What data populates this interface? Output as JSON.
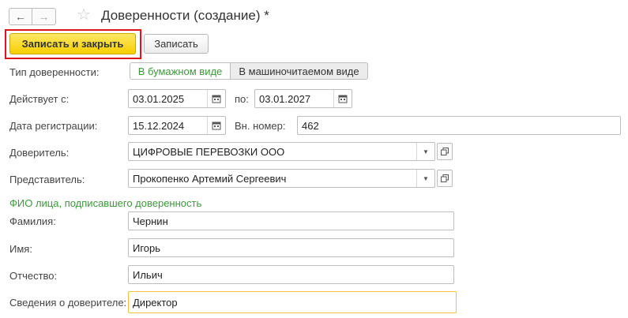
{
  "header": {
    "title": "Доверенности (создание) *",
    "back_icon": "arrow-left-icon",
    "forward_icon": "arrow-right-icon",
    "favorite_icon": "star-icon"
  },
  "toolbar": {
    "save_close_label": "Записать и закрыть",
    "save_label": "Записать"
  },
  "form": {
    "type": {
      "label": "Тип доверенности:",
      "options": [
        "В бумажном виде",
        "В машиночитаемом виде"
      ],
      "selected": "В бумажном виде"
    },
    "valid_from": {
      "label": "Действует с:",
      "value": "03.01.2025"
    },
    "valid_to": {
      "label": "по:",
      "value": "03.01.2027"
    },
    "reg_date": {
      "label": "Дата регистрации:",
      "value": "15.12.2024"
    },
    "int_number": {
      "label": "Вн. номер:",
      "value": "462"
    },
    "principal": {
      "label": "Доверитель:",
      "value": "ЦИФРОВЫЕ ПЕРЕВОЗКИ ООО"
    },
    "representative": {
      "label": "Представитель:",
      "value": "Прокопенко Артемий Сергеевич"
    },
    "signer_section": "ФИО лица, подписавшего доверенность",
    "last_name": {
      "label": "Фамилия:",
      "value": "Чернин"
    },
    "first_name": {
      "label": "Имя:",
      "value": "Игорь"
    },
    "patronymic": {
      "label": "Отчество:",
      "value": "Ильич"
    },
    "principal_info": {
      "label": "Сведения о доверителе:",
      "value": "Директор"
    }
  },
  "colors": {
    "accent_green": "#3a9a3a",
    "primary_button": "#f5cf00",
    "highlight_red": "#e0151a",
    "focus_border": "#f3c33b"
  }
}
